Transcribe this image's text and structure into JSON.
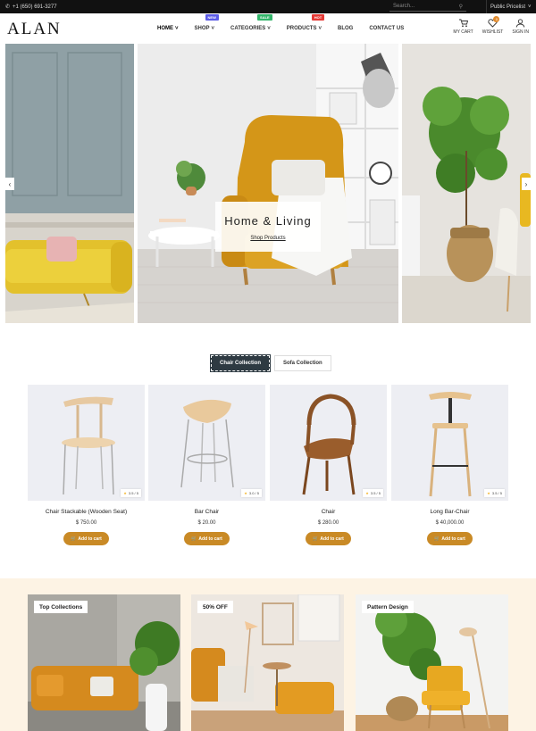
{
  "topbar": {
    "phone": "+1 (650) 691-3277",
    "search_placeholder": "Search...",
    "pricelist": "Public Pricelist"
  },
  "brand": {
    "logo": "ALAN"
  },
  "nav": {
    "items": [
      {
        "label": "HOME",
        "badge": "",
        "active": true
      },
      {
        "label": "SHOP",
        "badge": "NEW",
        "badge_color": "#5b5be6"
      },
      {
        "label": "CATEGORIES",
        "badge": "SALE",
        "badge_color": "#33b56a"
      },
      {
        "label": "PRODUCTS",
        "badge": "HOT",
        "badge_color": "#e53935"
      },
      {
        "label": "BLOG",
        "badge": ""
      },
      {
        "label": "CONTACT US",
        "badge": ""
      }
    ]
  },
  "header_icons": {
    "cart": {
      "label": "MY CART",
      "icon": "cart-icon"
    },
    "wishlist": {
      "label": "WISHLIST",
      "icon": "heart-icon",
      "count": "0"
    },
    "signin": {
      "label": "SIGN IN",
      "icon": "user-icon"
    }
  },
  "hero": {
    "title": "Home & Living",
    "link": "Shop Products"
  },
  "tabs": {
    "active": "Chair Collection",
    "idle": "Sofa Collection"
  },
  "products": [
    {
      "name": "Chair Stackable (Wooden Seat)",
      "price": "$ 750.00",
      "rating": "3.5 / 5",
      "cart": "Add to cart"
    },
    {
      "name": "Bar Chair",
      "price": "$ 20.00",
      "rating": "3.0 / 5",
      "cart": "Add to cart"
    },
    {
      "name": "Chair",
      "price": "$ 280.00",
      "rating": "3.5 / 5",
      "cart": "Add to cart"
    },
    {
      "name": "Long Bar-Chair",
      "price": "$ 40,000.00",
      "rating": "3.5 / 5",
      "cart": "Add to cart"
    }
  ],
  "promos": [
    {
      "label": "Top Collections"
    },
    {
      "label": "50% OFF"
    },
    {
      "label": "Pattern Design"
    }
  ],
  "colors": {
    "accent": "#c98a26",
    "dark": "#2e3a42",
    "promo_bg": "#fdf3e4"
  }
}
